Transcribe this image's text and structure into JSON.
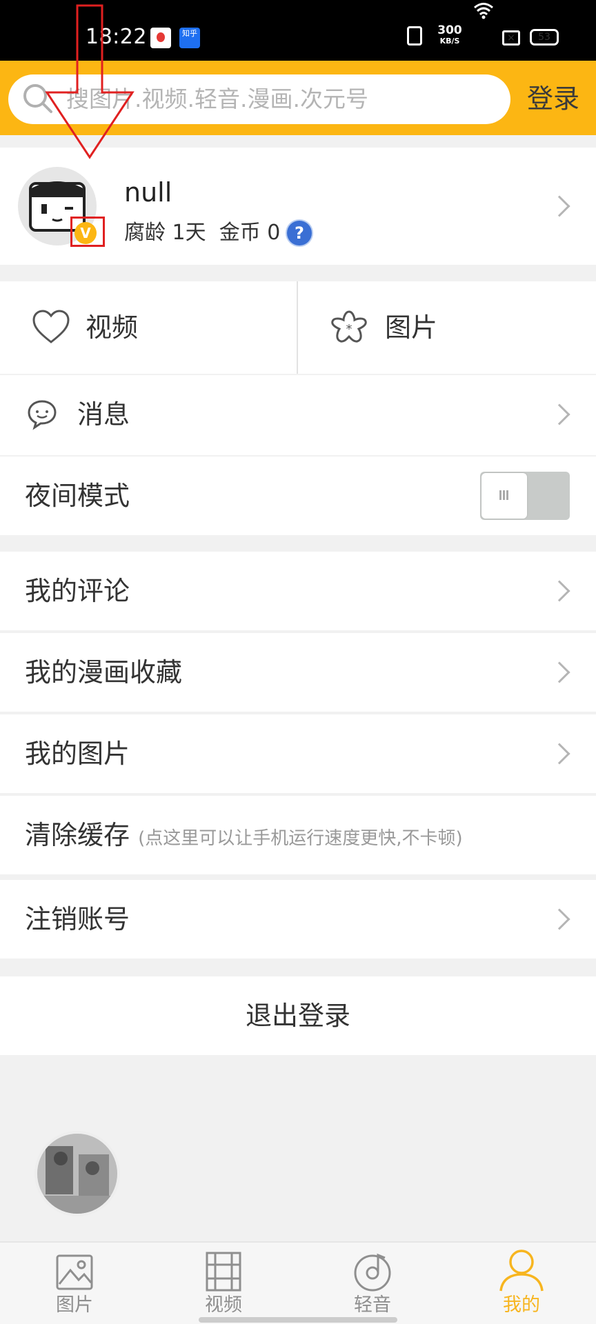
{
  "status_bar": {
    "time": "18:22",
    "notification_b": "知乎",
    "net_speed_value": "300",
    "net_speed_unit": "KB/S",
    "battery": "53"
  },
  "search": {
    "placeholder": "搜图片.视频.轻音.漫画.次元号",
    "login_label": "登录"
  },
  "profile": {
    "username": "null",
    "age_label": "腐龄 1天",
    "coins_label": "金币 0",
    "badge": "V",
    "help_symbol": "?"
  },
  "favorites": {
    "video_label": "视频",
    "image_label": "图片"
  },
  "menu": {
    "messages": "消息",
    "night_mode": "夜间模式",
    "my_comments": "我的评论",
    "my_comic_favorites": "我的漫画收藏",
    "my_images": "我的图片",
    "clear_cache": "清除缓存",
    "clear_cache_hint": "(点这里可以让手机运行速度更快,不卡顿)",
    "deactivate_account": "注销账号",
    "logout": "退出登录"
  },
  "night_mode_on": false,
  "tabs": [
    {
      "label": "图片",
      "icon": "image-icon",
      "active": false
    },
    {
      "label": "视频",
      "icon": "film-icon",
      "active": false
    },
    {
      "label": "轻音",
      "icon": "music-disc-icon",
      "active": false
    },
    {
      "label": "我的",
      "icon": "user-icon",
      "active": true
    }
  ],
  "colors": {
    "accent": "#fcb613",
    "active_tab": "#f7b51f",
    "annotation": "#e02020"
  }
}
